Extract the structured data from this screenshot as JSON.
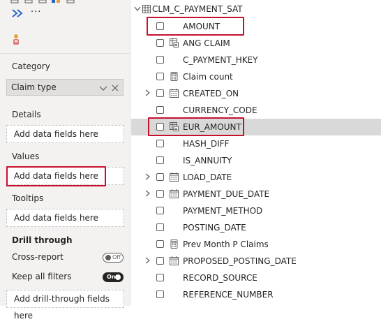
{
  "colors": {
    "highlight": "#c8102e",
    "accent": "#2b64c5",
    "pane_bg": "#f3f2f1"
  },
  "left": {
    "more_label": "···",
    "sections": {
      "category": {
        "label": "Category",
        "chip": "Claim type"
      },
      "details": {
        "label": "Details",
        "placeholder": "Add data fields here"
      },
      "values": {
        "label": "Values",
        "placeholder": "Add data fields here"
      },
      "tooltips": {
        "label": "Tooltips",
        "placeholder": "Add data fields here"
      },
      "drill": {
        "label": "Drill through",
        "cross_report": {
          "label": "Cross-report",
          "toggle": "Off"
        },
        "keep_filters": {
          "label": "Keep all filters",
          "toggle": "On"
        },
        "placeholder": "Add drill-through fields here"
      }
    }
  },
  "table": {
    "name": "CLM_C_PAYMENT_SAT",
    "fields": [
      {
        "name": "AMOUNT",
        "icon": "none",
        "expandable": false,
        "highlighted": true
      },
      {
        "name": "ANG CLAIM",
        "icon": "calc-column-icon",
        "expandable": false
      },
      {
        "name": "C_PAYMENT_HKEY",
        "icon": "none",
        "expandable": false
      },
      {
        "name": "Claim count",
        "icon": "measure-icon",
        "expandable": false
      },
      {
        "name": "CREATED_ON",
        "icon": "date-hierarchy-icon",
        "expandable": true
      },
      {
        "name": "CURRENCY_CODE",
        "icon": "none",
        "expandable": false
      },
      {
        "name": "EUR_AMOUNT",
        "icon": "calc-column-icon",
        "expandable": false,
        "highlighted": true,
        "selected": true
      },
      {
        "name": "HASH_DIFF",
        "icon": "none",
        "expandable": false
      },
      {
        "name": "IS_ANNUITY",
        "icon": "none",
        "expandable": false
      },
      {
        "name": "LOAD_DATE",
        "icon": "date-hierarchy-icon",
        "expandable": true
      },
      {
        "name": "PAYMENT_DUE_DATE",
        "icon": "date-hierarchy-icon",
        "expandable": true
      },
      {
        "name": "PAYMENT_METHOD",
        "icon": "none",
        "expandable": false
      },
      {
        "name": "POSTING_DATE",
        "icon": "none",
        "expandable": false
      },
      {
        "name": "Prev Month P Claims",
        "icon": "measure-icon",
        "expandable": false
      },
      {
        "name": "PROPOSED_POSTING_DATE",
        "icon": "date-hierarchy-icon",
        "expandable": true
      },
      {
        "name": "RECORD_SOURCE",
        "icon": "none",
        "expandable": false
      },
      {
        "name": "REFERENCE_NUMBER",
        "icon": "none",
        "expandable": false
      }
    ]
  }
}
